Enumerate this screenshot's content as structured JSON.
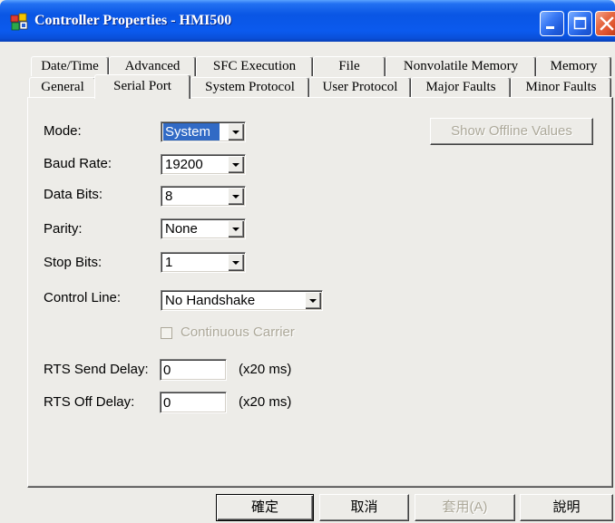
{
  "window": {
    "title": "Controller Properties - HMI500"
  },
  "icons": {
    "app": "controller-properties-icon",
    "minimize": "minimize-icon",
    "maximize": "maximize-icon",
    "close": "close-icon",
    "dropdown": "chevron-down-icon"
  },
  "tabs": {
    "back_row": [
      {
        "label": "Date/Time",
        "selected": false
      },
      {
        "label": "Advanced",
        "selected": false
      },
      {
        "label": "SFC Execution",
        "selected": false
      },
      {
        "label": "File",
        "selected": false
      },
      {
        "label": "Nonvolatile Memory",
        "selected": false
      },
      {
        "label": "Memory",
        "selected": false
      }
    ],
    "front_row": [
      {
        "label": "General",
        "selected": false
      },
      {
        "label": "Serial Port",
        "selected": true
      },
      {
        "label": "System Protocol",
        "selected": false
      },
      {
        "label": "User Protocol",
        "selected": false
      },
      {
        "label": "Major Faults",
        "selected": false
      },
      {
        "label": "Minor Faults",
        "selected": false
      }
    ]
  },
  "serial_port": {
    "mode": {
      "label": "Mode:",
      "value": "System"
    },
    "show_offline_values": {
      "label": "Show Offline Values",
      "enabled": false
    },
    "baud_rate": {
      "label": "Baud Rate:",
      "value": "19200"
    },
    "data_bits": {
      "label": "Data Bits:",
      "value": "8"
    },
    "parity": {
      "label": "Parity:",
      "value": "None"
    },
    "stop_bits": {
      "label": "Stop Bits:",
      "value": "1"
    },
    "control_line": {
      "label": "Control Line:",
      "value": "No Handshake"
    },
    "continuous_carrier": {
      "label": "Continuous Carrier",
      "checked": false,
      "enabled": false
    },
    "rts_send_delay": {
      "label": "RTS Send Delay:",
      "value": "0",
      "unit": "(x20 ms)"
    },
    "rts_off_delay": {
      "label": "RTS Off Delay:",
      "value": "0",
      "unit": "(x20 ms)"
    }
  },
  "buttons": {
    "ok": {
      "label": "確定",
      "default": true
    },
    "cancel": {
      "label": "取消"
    },
    "apply": {
      "label": "套用(A)",
      "enabled": false
    },
    "help": {
      "label": "說明"
    }
  },
  "colors": {
    "title_bar": "#0A56E4",
    "selection": "#316AC5",
    "disabled_text": "#ACA899",
    "close_button": "#E1542F",
    "dialog_background": "#EDECE8"
  }
}
